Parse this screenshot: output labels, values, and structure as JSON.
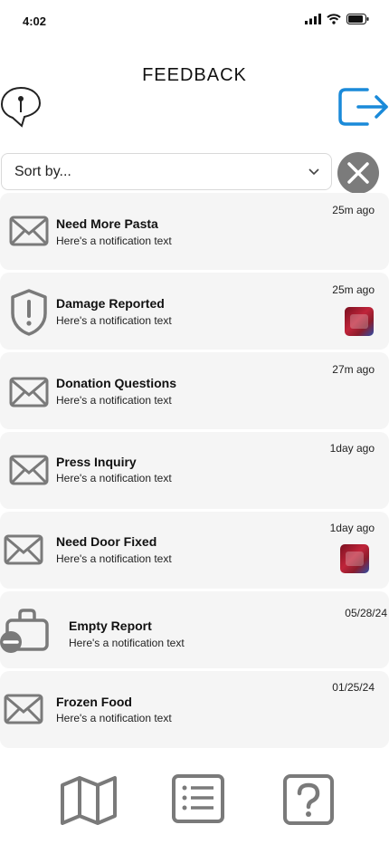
{
  "status_bar": {
    "time": "4:02"
  },
  "header": {
    "title": "FEEDBACK"
  },
  "sort": {
    "value": "Sort by..."
  },
  "notifications": [
    {
      "title": "Need More Pasta",
      "text": "Here's a notification text",
      "time": "25m ago",
      "icon": "envelope-icon",
      "has_thumbnail": false
    },
    {
      "title": "Damage Reported",
      "text": "Here's a notification text",
      "time": "25m ago",
      "icon": "shield-alert-icon",
      "has_thumbnail": true
    },
    {
      "title": "Donation Questions",
      "text": "Here's a notification text",
      "time": "27m ago",
      "icon": "envelope-icon",
      "has_thumbnail": false
    },
    {
      "title": "Press Inquiry",
      "text": "Here's a notification text",
      "time": "1day ago",
      "icon": "envelope-icon",
      "has_thumbnail": false
    },
    {
      "title": "Need Door Fixed",
      "text": "Here's a notification text",
      "time": "1day ago",
      "icon": "envelope-icon",
      "has_thumbnail": true
    },
    {
      "title": "Empty Report",
      "text": "Here's a notification text",
      "time": "05/28/24",
      "icon": "briefcase-minus-icon",
      "has_thumbnail": false
    },
    {
      "title": "Frozen Food",
      "text": "Here's a notification text",
      "time": "01/25/24",
      "icon": "envelope-icon",
      "has_thumbnail": false
    }
  ],
  "bottom_nav": [
    {
      "icon": "map-icon"
    },
    {
      "icon": "list-icon"
    },
    {
      "icon": "help-icon"
    }
  ],
  "colors": {
    "accent": "#1a8ad9",
    "icon_gray": "#7a7a7a",
    "card_bg": "#f5f5f5"
  }
}
